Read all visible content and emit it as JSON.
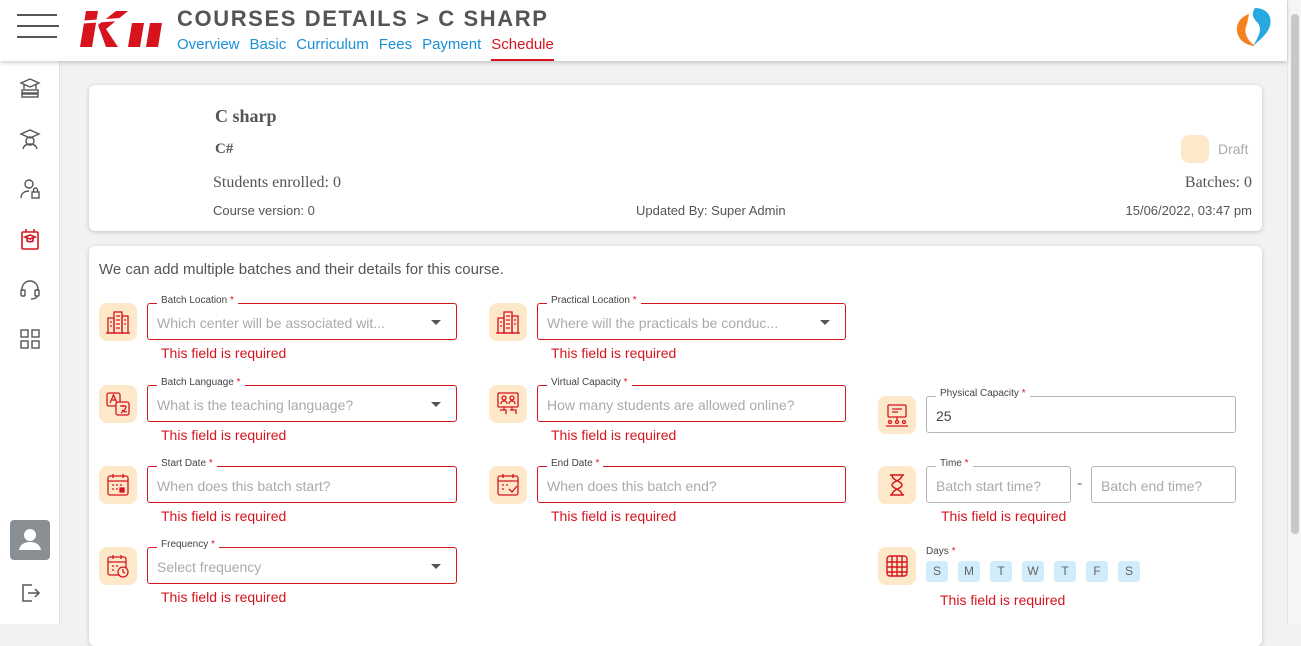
{
  "header": {
    "title": "COURSES DETAILS > C SHARP",
    "tabs": [
      {
        "label": "Overview",
        "active": false
      },
      {
        "label": "Basic",
        "active": false
      },
      {
        "label": "Curriculum",
        "active": false
      },
      {
        "label": "Fees",
        "active": false
      },
      {
        "label": "Payment",
        "active": false
      },
      {
        "label": "Schedule",
        "active": true
      }
    ],
    "logo_text": "Kii"
  },
  "sidebar": {
    "items": [
      {
        "icon": "books-icon"
      },
      {
        "icon": "graduate-icon"
      },
      {
        "icon": "user-lock-icon"
      },
      {
        "icon": "courses-icon",
        "active": true
      },
      {
        "icon": "headset-icon"
      },
      {
        "icon": "dashboard-grid-icon"
      }
    ]
  },
  "course": {
    "name": "C sharp",
    "code": "C#",
    "status": "Draft",
    "students_enrolled": "Students enrolled: 0",
    "batches": "Batches: 0",
    "version": "Course version: 0",
    "updated_by": "Updated By: Super Admin",
    "updated_at": "15/06/2022, 03:47 pm"
  },
  "schedule": {
    "intro": "We can add multiple batches and their details for this course.",
    "error_text": "This field is required",
    "batch_location": {
      "label": "Batch Location",
      "placeholder": "Which center will be associated wit..."
    },
    "practical_location": {
      "label": "Practical Location",
      "placeholder": "Where will the practicals be conduc..."
    },
    "batch_language": {
      "label": "Batch Language",
      "placeholder": "What is the teaching language?"
    },
    "virtual_capacity": {
      "label": "Virtual Capacity",
      "placeholder": "How many students are allowed online?"
    },
    "physical_capacity": {
      "label": "Physical Capacity",
      "value": "25"
    },
    "start_date": {
      "label": "Start Date",
      "placeholder": "When does this batch start?"
    },
    "end_date": {
      "label": "End Date",
      "placeholder": "When does this batch end?"
    },
    "time": {
      "label": "Time",
      "start_placeholder": "Batch start time?",
      "end_placeholder": "Batch end time?",
      "separator": "-"
    },
    "frequency": {
      "label": "Frequency",
      "placeholder": "Select frequency"
    },
    "days": {
      "label": "Days",
      "items": [
        "S",
        "M",
        "T",
        "W",
        "T",
        "F",
        "S"
      ]
    },
    "required_mark": "*"
  },
  "colors": {
    "accent": "#d7141e",
    "link": "#1a8fd6",
    "icon_bg": "#fde9c9",
    "day_chip": "#d1ecfa"
  }
}
